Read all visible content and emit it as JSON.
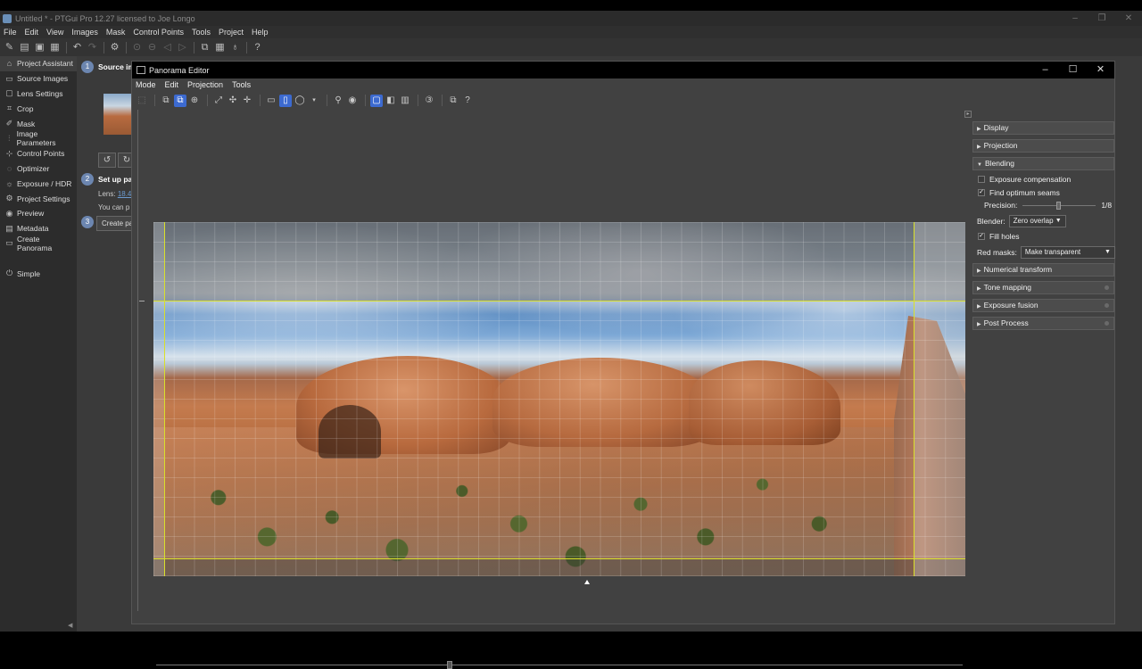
{
  "main_window": {
    "title": "Untitled * - PTGui Pro 12.27 licensed to Joe Longo",
    "menu": [
      "File",
      "Edit",
      "View",
      "Images",
      "Mask",
      "Control Points",
      "Tools",
      "Project",
      "Help"
    ],
    "toolbar_icons": [
      "new-project-icon",
      "open-icon",
      "save-icon",
      "save-as-icon",
      "undo-icon",
      "redo-icon",
      "settings-icon",
      "zoom-fit-icon",
      "zoom-out-icon",
      "prev-icon",
      "next-icon",
      "panorama-editor-icon",
      "table-icon",
      "pin-icon",
      "help-icon"
    ]
  },
  "sidebar": {
    "items": [
      {
        "label": "Project Assistant",
        "icon": "home-icon",
        "active": true
      },
      {
        "label": "Source Images",
        "icon": "images-icon"
      },
      {
        "label": "Lens Settings",
        "icon": "lens-icon"
      },
      {
        "label": "Crop",
        "icon": "crop-icon"
      },
      {
        "label": "Mask",
        "icon": "brush-icon"
      },
      {
        "label": "Image Parameters",
        "icon": "sliders-icon"
      },
      {
        "label": "Control Points",
        "icon": "control-points-icon"
      },
      {
        "label": "Optimizer",
        "icon": "optimizer-icon"
      },
      {
        "label": "Exposure / HDR",
        "icon": "sun-icon"
      },
      {
        "label": "Project Settings",
        "icon": "gear-icon"
      },
      {
        "label": "Preview",
        "icon": "eye-icon"
      },
      {
        "label": "Metadata",
        "icon": "metadata-icon"
      },
      {
        "label": "Create Panorama",
        "icon": "panorama-icon"
      }
    ],
    "simple_label": "Simple"
  },
  "assistant": {
    "step1_num": "1",
    "step1_label": "Source im",
    "step2_num": "2",
    "step2_label": "Set up pa",
    "lens_label": "Lens:",
    "lens_value": "18.4",
    "you_can": "You can p",
    "step3_num": "3",
    "create_label": "Create pa"
  },
  "editor": {
    "title": "Panorama Editor",
    "menu": [
      "Mode",
      "Edit",
      "Projection",
      "Tools"
    ],
    "right_panel": {
      "sections_top": [
        "Display",
        "Projection",
        "Blending"
      ],
      "exposure_compensation": {
        "label": "Exposure compensation",
        "checked": false
      },
      "find_seams": {
        "label": "Find optimum seams",
        "checked": true
      },
      "precision_label": "Precision:",
      "precision_value": "1/8",
      "precision_level": 0.5,
      "blender_label": "Blender:",
      "blender_value": "Zero overlap",
      "fill_holes": {
        "label": "Fill holes",
        "checked": true
      },
      "red_masks_label": "Red masks:",
      "red_masks_value": "Make transparent",
      "sections_bottom": [
        "Numerical transform",
        "Tone mapping",
        "Exposure fusion",
        "Post Process"
      ]
    }
  },
  "colors": {
    "accent": "#3c6ad0",
    "crop_line": "#d9e02a",
    "step_badge": "#6c86b0"
  }
}
